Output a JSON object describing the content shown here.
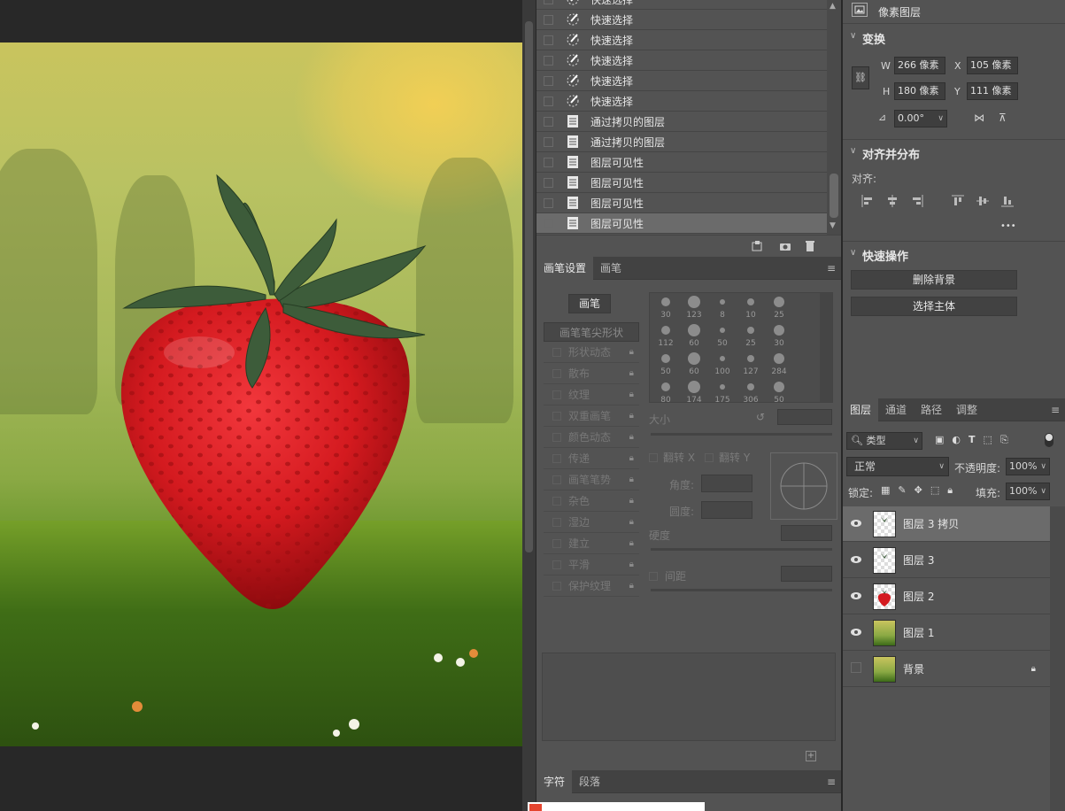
{
  "history": {
    "items": [
      {
        "label": "快速选择",
        "icon": "quick-select-icon"
      },
      {
        "label": "快速选择",
        "icon": "quick-select-icon"
      },
      {
        "label": "快速选择",
        "icon": "quick-select-icon"
      },
      {
        "label": "快速选择",
        "icon": "quick-select-icon"
      },
      {
        "label": "快速选择",
        "icon": "quick-select-icon"
      },
      {
        "label": "快速选择",
        "icon": "quick-select-icon"
      },
      {
        "label": "通过拷贝的图层",
        "icon": "document-icon"
      },
      {
        "label": "通过拷贝的图层",
        "icon": "document-icon"
      },
      {
        "label": "图层可见性",
        "icon": "document-icon"
      },
      {
        "label": "图层可见性",
        "icon": "document-icon"
      },
      {
        "label": "图层可见性",
        "icon": "document-icon"
      },
      {
        "label": "图层可见性",
        "icon": "document-icon"
      }
    ]
  },
  "brush_panel": {
    "tabs": [
      "画笔设置",
      "画笔"
    ],
    "brushes_button": "画笔",
    "tip_shape_title": "画笔笔尖形状",
    "options": [
      "形状动态",
      "散布",
      "纹理",
      "双重画笔",
      "颜色动态",
      "传递",
      "画笔笔势",
      "杂色",
      "湿边",
      "建立",
      "平滑",
      "保护纹理"
    ],
    "presets": [
      "30",
      "123",
      "8",
      "10",
      "25",
      "112",
      "60",
      "50",
      "25",
      "30",
      "50",
      "60",
      "100",
      "127",
      "284",
      "80",
      "174",
      "175",
      "306",
      "50"
    ],
    "size_label": "大小",
    "flip_x": "翻转 X",
    "flip_y": "翻转 Y",
    "angle_label": "角度:",
    "roundness_label": "圆度:",
    "hardness_label": "硬度",
    "spacing_label": "间距"
  },
  "char_panel": {
    "tabs": [
      "字符",
      "段落"
    ]
  },
  "properties": {
    "header": "像素图层",
    "transform_title": "变换",
    "w_label": "W",
    "w_value": "266 像素",
    "x_label": "X",
    "x_value": "105 像素",
    "h_label": "H",
    "h_value": "180 像素",
    "y_label": "Y",
    "y_value": "111 像素",
    "angle_value": "0.00°",
    "align_title": "对齐并分布",
    "align_label": "对齐:",
    "more": "•••",
    "quick_title": "快速操作",
    "remove_bg": "删除背景",
    "select_subject": "选择主体"
  },
  "layers_panel": {
    "tabs": [
      "图层",
      "通道",
      "路径",
      "调整"
    ],
    "filter_kind": "类型",
    "blend_mode": "正常",
    "opacity_label": "不透明度:",
    "opacity_value": "100%",
    "lock_label": "锁定:",
    "fill_label": "填充:",
    "fill_value": "100%",
    "layers": [
      {
        "name": "图层 3 拷贝",
        "visible": true,
        "selected": true,
        "thumb": "leaf"
      },
      {
        "name": "图层 3",
        "visible": true,
        "selected": false,
        "thumb": "leaf"
      },
      {
        "name": "图层 2",
        "visible": true,
        "selected": false,
        "thumb": "strawberry"
      },
      {
        "name": "图层 1",
        "visible": true,
        "selected": false,
        "thumb": "landscape"
      },
      {
        "name": "背景",
        "visible": false,
        "selected": false,
        "thumb": "landscape",
        "locked": true
      }
    ]
  },
  "colors": {
    "panel": "#535353",
    "selected_row": "#6b6b6b",
    "canvas_bg": "#282828",
    "strawberry": "#d41a1f"
  }
}
